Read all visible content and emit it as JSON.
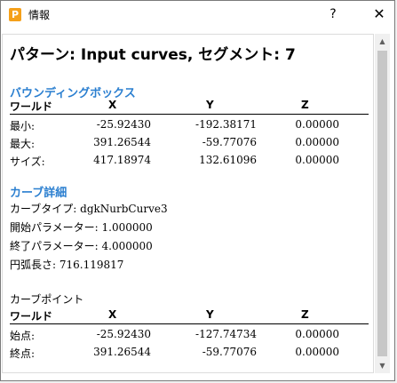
{
  "window": {
    "title": "情報",
    "icon_letter": "P",
    "help": "?",
    "close": "✕"
  },
  "heading": "パターン: Input curves, セグメント: 7",
  "bbox": {
    "section": "バウンディングボックス",
    "headers": [
      "ワールド",
      "X",
      "Y",
      "Z"
    ],
    "rows": [
      {
        "label": "最小:",
        "x": "-25.92430",
        "y": "-192.38171",
        "z": "0.00000"
      },
      {
        "label": "最大:",
        "x": "391.26544",
        "y": "-59.77076",
        "z": "0.00000"
      },
      {
        "label": "サイズ:",
        "x": "417.18974",
        "y": "132.61096",
        "z": "0.00000"
      }
    ]
  },
  "curve": {
    "section": "カーブ詳細",
    "lines": [
      "カーブタイプ: dgkNurbCurve3",
      "開始パラメーター: 1.000000",
      "終了パラメーター: 4.000000",
      "円弧長さ: 716.119817"
    ]
  },
  "points": {
    "section": "カーブポイント",
    "headers": [
      "ワールド",
      "X",
      "Y",
      "Z"
    ],
    "rows": [
      {
        "label": "始点:",
        "x": "-25.92430",
        "y": "-127.74734",
        "z": "0.00000"
      },
      {
        "label": "終点:",
        "x": "391.26544",
        "y": "-59.77076",
        "z": "0.00000"
      }
    ]
  }
}
